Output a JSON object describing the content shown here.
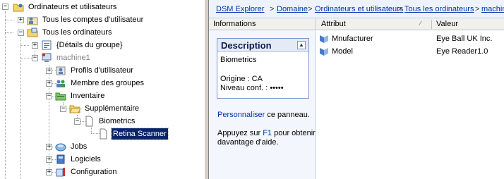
{
  "tree": {
    "root": "Ordinateurs et utilisateurs",
    "all_accounts": "Tous les comptes d'utilisateur",
    "all_computers": "Tous les ordinateurs",
    "group_details": "{Détails du groupe}",
    "machine": "machine1",
    "profiles": "Profils d'utilisateur",
    "group_member": "Membre des groupes",
    "inventory": "Inventaire",
    "supplementary": "Supplémentaire",
    "biometrics": "Biometrics",
    "retina": "Retina Scanner",
    "jobs": "Jobs",
    "software": "Logiciels",
    "configuration": "Configuration"
  },
  "breadcrumb": {
    "items": [
      "DSM Explorer",
      "Domaine",
      "Ordinateurs et utilisateurs",
      "Tous les ordinateurs",
      "machine"
    ],
    "separator": ">"
  },
  "info_panel": {
    "header": "Informations",
    "description_title": "Description",
    "description_name": "Biometrics",
    "origin": "Origine : CA",
    "level": "Niveau conf. : •••••",
    "personalize_link": "Personnaliser",
    "personalize_rest": " ce panneau.",
    "help_before": "Appuyez sur ",
    "help_key": "F1",
    "help_after": " pour obtenir davantage d'aide."
  },
  "list": {
    "col_attribute": "Attribut",
    "col_value": "Valeur",
    "rows": [
      {
        "attribute": "Mnufacturer",
        "value": "Eye Ball UK Inc."
      },
      {
        "attribute": "Model",
        "value": "Eye Reader1.0"
      }
    ]
  },
  "colors": {
    "selection": "#0a246a",
    "link": "#0033aa",
    "panel_bg": "#f3f6fc"
  }
}
